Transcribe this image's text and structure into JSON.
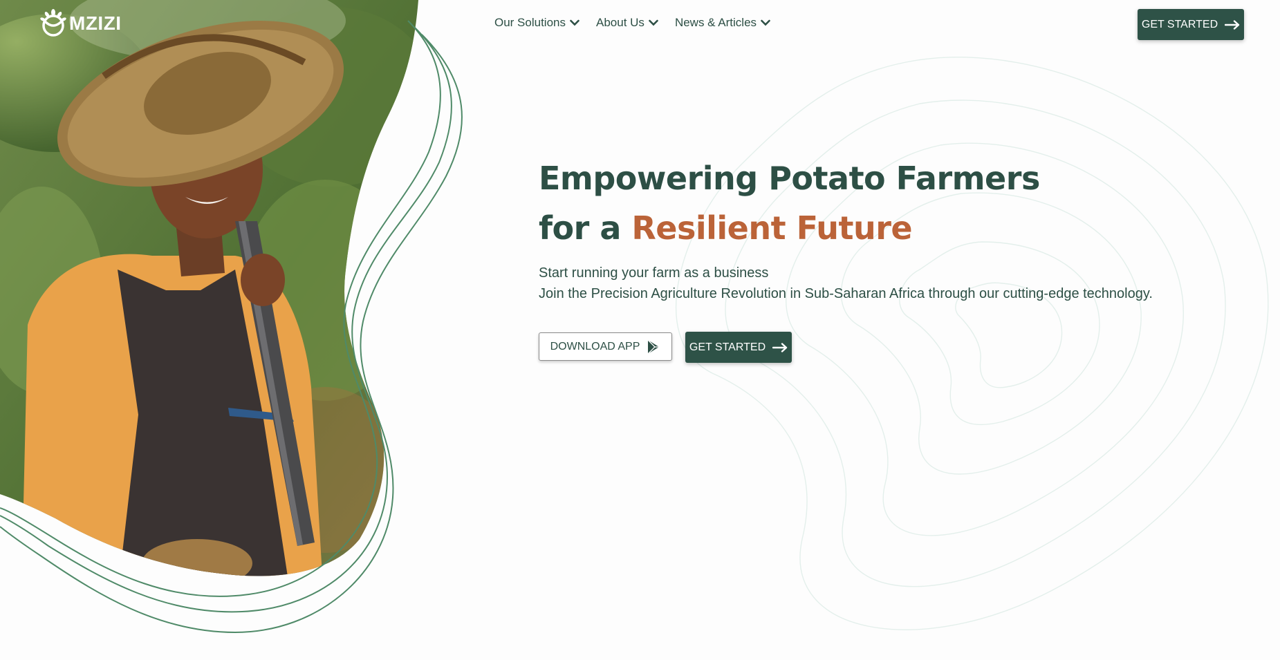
{
  "brand": {
    "name": "MZIZI",
    "primary_color": "#2e5247",
    "accent_color": "#bb6338"
  },
  "nav": {
    "items": [
      {
        "label": "Our Solutions",
        "icon": "chevron-down-icon"
      },
      {
        "label": "About Us",
        "icon": "chevron-down-icon"
      },
      {
        "label": "News & Articles",
        "icon": "chevron-down-icon"
      }
    ],
    "cta_label": "GET STARTED",
    "cta_icon": "arrow-right-icon"
  },
  "hero": {
    "title_line1": "Empowering Potato Farmers",
    "title_line2_prefix": "for a ",
    "title_line2_accent": "Resilient Future",
    "subtitle_line1": "Start running your farm as a business",
    "subtitle_line2": "Join the Precision Agriculture Revolution in Sub-Saharan Africa through our cutting-edge technology.",
    "download_label": "DOWNLOAD APP",
    "download_icon": "play-store-icon",
    "start_label": "GET STARTED",
    "start_icon": "arrow-right-icon",
    "image_alt": "farmer-photo"
  }
}
